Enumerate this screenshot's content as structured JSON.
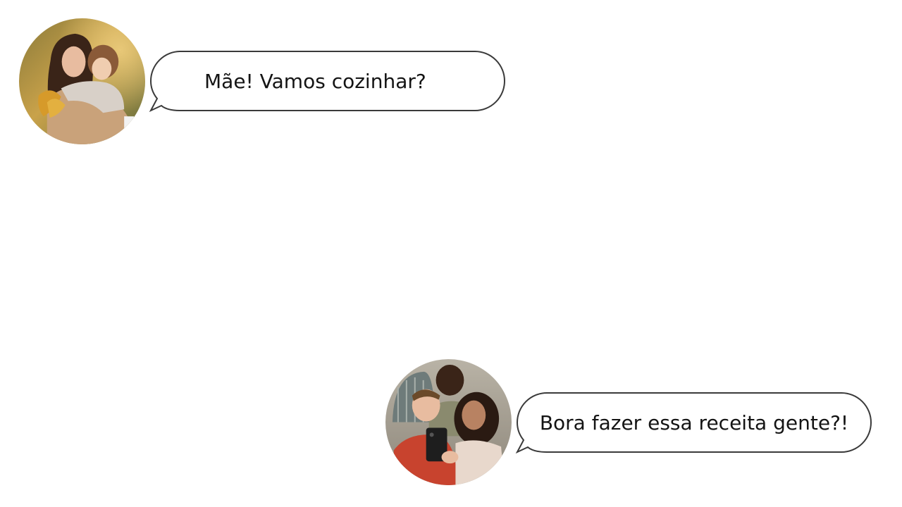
{
  "conversation": {
    "messages": [
      {
        "sender": "mother-and-child",
        "avatar_icon": "mother-child-photo-avatar",
        "text": "Mãe! Vamos cozinhar?",
        "align": "left"
      },
      {
        "sender": "group-of-friends",
        "avatar_icon": "friends-group-photo-avatar",
        "text": "Bora fazer essa receita gente?!",
        "align": "right"
      }
    ]
  },
  "colors": {
    "background": "#ffffff",
    "bubble_fill": "#ffffff",
    "bubble_stroke": "#3a3a3a",
    "text": "#141414"
  }
}
